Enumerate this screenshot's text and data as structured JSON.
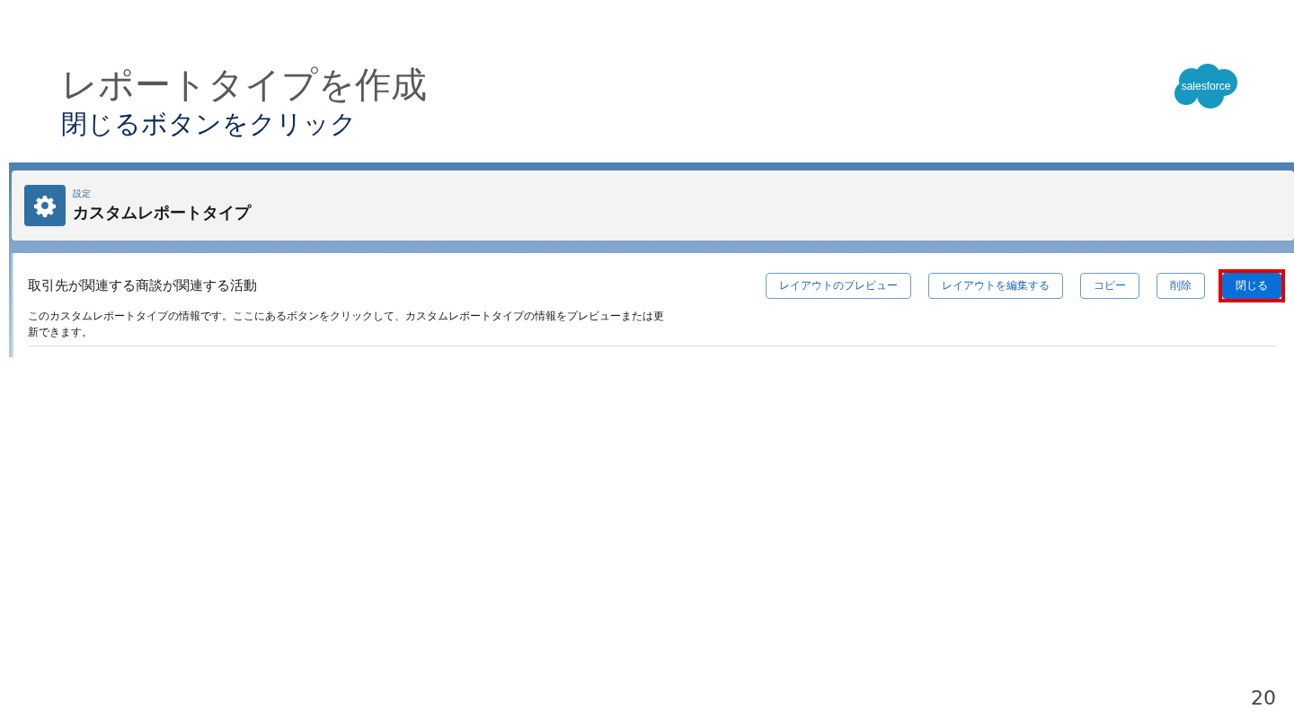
{
  "slide": {
    "title": "レポートタイプを作成",
    "subtitle": "閉じるボタンをクリック",
    "logo": "salesforce",
    "page_number": "20"
  },
  "header": {
    "breadcrumb": "設定",
    "title": "カスタムレポートタイプ"
  },
  "record": {
    "title": "取引先が関連する商談が関連する活動",
    "description": "このカスタムレポートタイプの情報です。ここにあるボタンをクリックして、カスタムレポートタイプの情報をプレビューまたは更新できます。",
    "buttons": [
      {
        "label": "レイアウトのプレビュー",
        "kind": "neutral",
        "highlighted": false
      },
      {
        "label": "レイアウトを編集する",
        "kind": "neutral",
        "highlighted": false
      },
      {
        "label": "コピー",
        "kind": "neutral",
        "highlighted": false
      },
      {
        "label": "削除",
        "kind": "neutral",
        "highlighted": false
      },
      {
        "label": "閉じる",
        "kind": "brand",
        "highlighted": true
      }
    ]
  }
}
